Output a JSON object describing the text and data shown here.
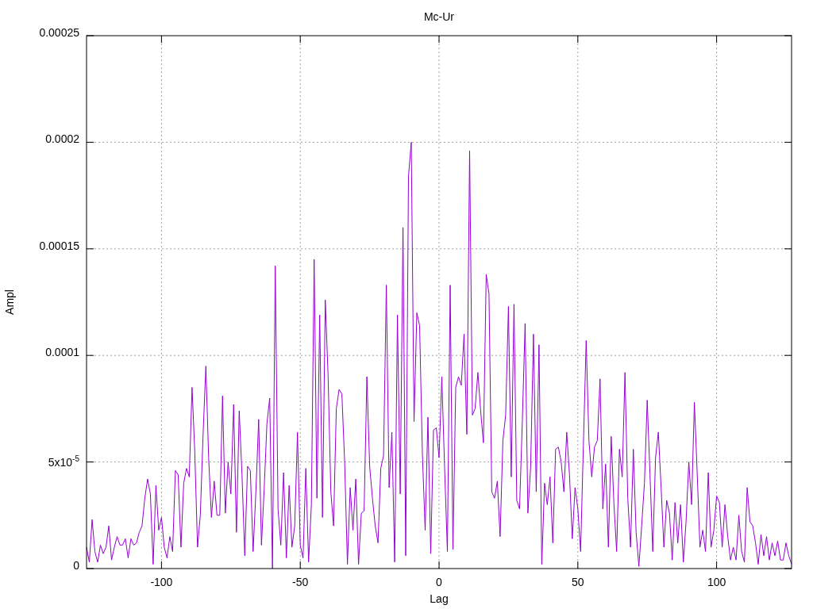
{
  "chart_data": {
    "type": "line",
    "grid": true,
    "title": "Mc-Ur",
    "xlabel": "Lag",
    "ylabel": "Ampl",
    "xlim": [
      -127,
      127
    ],
    "ylim": [
      0,
      0.00025
    ],
    "xticks": [
      -100,
      -50,
      0,
      50,
      100
    ],
    "yticks": [
      {
        "value": 0,
        "label": "0"
      },
      {
        "value": 5e-05,
        "label": "5x10$^{-5}$"
      },
      {
        "value": 0.0001,
        "label": "0.0001"
      },
      {
        "value": 0.00015,
        "label": "0.00015"
      },
      {
        "value": 0.0002,
        "label": "0.0002"
      },
      {
        "value": 0.00025,
        "label": "0.00025"
      }
    ],
    "x": [
      -127,
      -126,
      -125,
      -124,
      -123,
      -122,
      -121,
      -120,
      -119,
      -118,
      -117,
      -116,
      -115,
      -114,
      -113,
      -112,
      -111,
      -110,
      -109,
      -108,
      -107,
      -106,
      -105,
      -104,
      -103,
      -102,
      -101,
      -100,
      -99,
      -98,
      -97,
      -96,
      -95,
      -94,
      -93,
      -92,
      -91,
      -90,
      -89,
      -88,
      -87,
      -86,
      -85,
      -84,
      -83,
      -82,
      -81,
      -80,
      -79,
      -78,
      -77,
      -76,
      -75,
      -74,
      -73,
      -72,
      -71,
      -70,
      -69,
      -68,
      -67,
      -66,
      -65,
      -64,
      -63,
      -62,
      -61,
      -60,
      -59,
      -58,
      -57,
      -56,
      -55,
      -54,
      -53,
      -52,
      -51,
      -50,
      -49,
      -48,
      -47,
      -46,
      -45,
      -44,
      -43,
      -42,
      -41,
      -40,
      -39,
      -38,
      -37,
      -36,
      -35,
      -34,
      -33,
      -32,
      -31,
      -30,
      -29,
      -28,
      -27,
      -26,
      -25,
      -24,
      -23,
      -22,
      -21,
      -20,
      -19,
      -18,
      -17,
      -16,
      -15,
      -14,
      -13,
      -12,
      -11,
      -10,
      -9,
      -8,
      -7,
      -6,
      -5,
      -4,
      -3,
      -2,
      -1,
      0,
      1,
      2,
      3,
      4,
      5,
      6,
      7,
      8,
      9,
      10,
      11,
      12,
      13,
      14,
      15,
      16,
      17,
      18,
      19,
      20,
      21,
      22,
      23,
      24,
      25,
      26,
      27,
      28,
      29,
      30,
      31,
      32,
      33,
      34,
      35,
      36,
      37,
      38,
      39,
      40,
      41,
      42,
      43,
      44,
      45,
      46,
      47,
      48,
      49,
      50,
      51,
      52,
      53,
      54,
      55,
      56,
      57,
      58,
      59,
      60,
      61,
      62,
      63,
      64,
      65,
      66,
      67,
      68,
      69,
      70,
      71,
      72,
      73,
      74,
      75,
      76,
      77,
      78,
      79,
      80,
      81,
      82,
      83,
      84,
      85,
      86,
      87,
      88,
      89,
      90,
      91,
      92,
      93,
      94,
      95,
      96,
      97,
      98,
      99,
      100,
      101,
      102,
      103,
      104,
      105,
      106,
      107,
      108,
      109,
      110,
      111,
      112,
      113,
      114,
      115,
      116,
      117,
      118,
      119,
      120,
      121,
      122,
      123,
      124,
      125,
      126,
      127
    ],
    "series": [
      {
        "color": "#9400d3",
        "values": [
          1e-05,
          3e-06,
          2.3e-05,
          8e-06,
          3e-06,
          1.1e-05,
          7e-06,
          1e-05,
          2e-05,
          4e-06,
          1e-05,
          1.5e-05,
          1.1e-05,
          1.1e-05,
          1.4e-05,
          5e-06,
          1.4e-05,
          1.1e-05,
          1.2e-05,
          1.7e-05,
          2e-05,
          3.3e-05,
          4.2e-05,
          3.5e-05,
          2e-06,
          3.9e-05,
          1.8e-05,
          2.4e-05,
          1e-05,
          5e-06,
          1.5e-05,
          8e-06,
          4.6e-05,
          4.4e-05,
          1e-05,
          4e-05,
          4.7e-05,
          4.3e-05,
          8.5e-05,
          5.5e-05,
          1e-05,
          2.5e-05,
          6.3e-05,
          9.5e-05,
          5.2e-05,
          2.4e-05,
          4.1e-05,
          2.5e-05,
          2.5e-05,
          8.1e-05,
          2.6e-05,
          5e-05,
          3.5e-05,
          7.7e-05,
          1.7e-05,
          7.4e-05,
          4.4e-05,
          6e-06,
          4.8e-05,
          4.6e-05,
          8e-06,
          3.6e-05,
          7e-05,
          1.1e-05,
          3.7e-05,
          6.8e-05,
          8e-05,
          0.0,
          0.000142,
          2.8e-05,
          1.1e-05,
          4.5e-05,
          5e-06,
          3.9e-05,
          1e-05,
          2e-05,
          6.4e-05,
          1.1e-05,
          5e-06,
          4.7e-05,
          3e-06,
          3e-05,
          0.000145,
          3.3e-05,
          0.000119,
          2.4e-05,
          0.000126,
          9.1e-05,
          3.6e-05,
          2e-05,
          7.5e-05,
          8.4e-05,
          8.2e-05,
          5e-05,
          2e-06,
          3.8e-05,
          1.8e-05,
          4.2e-05,
          2e-06,
          2.6e-05,
          2.7e-05,
          9e-05,
          4.8e-05,
          3.3e-05,
          2e-05,
          1.2e-05,
          4.7e-05,
          5.3e-05,
          0.000133,
          3.8e-05,
          6.4e-05,
          3e-06,
          0.000119,
          3.5e-05,
          0.00016,
          6e-06,
          0.000184,
          0.0002,
          6.9e-05,
          0.00012,
          0.000114,
          5.4e-05,
          1.8e-05,
          7.1e-05,
          7e-06,
          6.5e-05,
          6.6e-05,
          5.2e-05,
          9e-05,
          4.7e-05,
          8e-06,
          0.000133,
          9e-06,
          8.5e-05,
          9e-05,
          8.6e-05,
          0.00011,
          6.3e-05,
          0.000196,
          7.2e-05,
          7.5e-05,
          9.2e-05,
          7.4e-05,
          5.9e-05,
          0.000138,
          0.000129,
          3.6e-05,
          3.3e-05,
          4.1e-05,
          1.5e-05,
          6e-05,
          7.2e-05,
          0.000123,
          4.3e-05,
          0.000124,
          3.2e-05,
          2.8e-05,
          6.9e-05,
          0.000115,
          2.6e-05,
          4.8e-05,
          0.00011,
          3.6e-05,
          0.000105,
          2e-06,
          4e-05,
          3e-05,
          4.3e-05,
          1.2e-05,
          5.6e-05,
          5.7e-05,
          5e-05,
          3.6e-05,
          6.4e-05,
          4.4e-05,
          1.4e-05,
          3.8e-05,
          2.8e-05,
          8e-06,
          5.8e-05,
          0.000107,
          6e-05,
          4.3e-05,
          5.7e-05,
          6e-05,
          8.9e-05,
          2.8e-05,
          4.9e-05,
          1e-05,
          6.2e-05,
          3e-05,
          8e-06,
          5.6e-05,
          4.3e-05,
          9.2e-05,
          3.3e-05,
          1e-05,
          5.6e-05,
          1.7e-05,
          1e-06,
          2e-05,
          4e-05,
          7.9e-05,
          4.4e-05,
          8e-06,
          5.2e-05,
          6.4e-05,
          3.8e-05,
          1e-05,
          3.2e-05,
          2.6e-05,
          4e-06,
          3.1e-05,
          1.2e-05,
          3e-05,
          3e-06,
          2.2e-05,
          5e-05,
          3e-05,
          7.8e-05,
          4.5e-05,
          1e-05,
          1.8e-05,
          8e-06,
          4.5e-05,
          1e-05,
          1.8e-05,
          3.4e-05,
          3.1e-05,
          1e-05,
          3e-05,
          1.5e-05,
          4e-06,
          1e-05,
          4e-06,
          2.5e-05,
          8e-06,
          3e-06,
          3.8e-05,
          2.2e-05,
          2e-05,
          1.2e-05,
          2e-06,
          1.6e-05,
          6e-06,
          1.5e-05,
          4e-06,
          1.2e-05,
          6e-06,
          1.3e-05,
          4e-06,
          4e-06,
          1.2e-05,
          6e-06,
          2e-06
        ]
      }
    ]
  }
}
